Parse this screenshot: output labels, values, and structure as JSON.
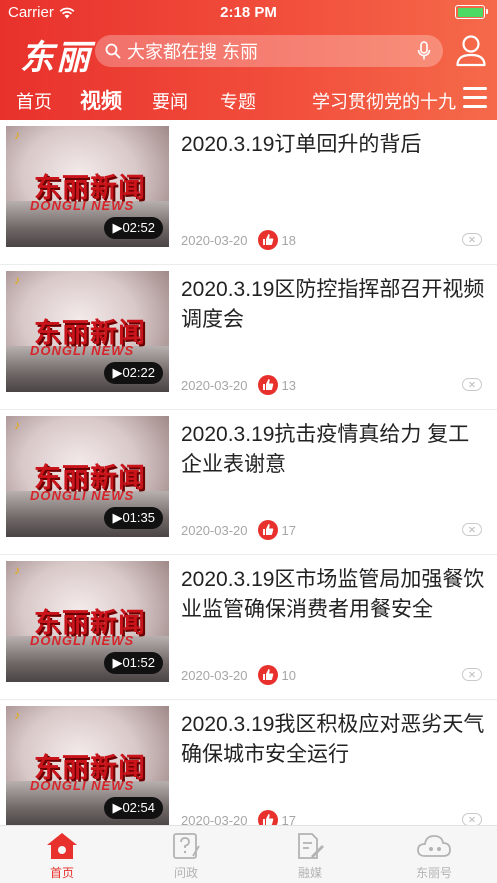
{
  "status_bar": {
    "carrier": "Carrier",
    "time": "2:18 PM"
  },
  "header": {
    "logo": "东丽",
    "search_placeholder": "大家都在搜 东丽",
    "icons": {
      "search": "search-icon",
      "mic": "mic-icon",
      "user": "user-icon"
    }
  },
  "nav": {
    "tabs": [
      {
        "label": "首页",
        "active": false
      },
      {
        "label": "视频",
        "active": true
      },
      {
        "label": "要闻",
        "active": false
      },
      {
        "label": "专题",
        "active": false
      },
      {
        "label": "学习贯彻党的十九",
        "active": false
      }
    ],
    "menu_icon": "menu-icon"
  },
  "thumbnail": {
    "title_cn": "东丽新闻",
    "title_en": "DONGLI NEWS"
  },
  "articles": [
    {
      "title": "2020.3.19订单回升的背后",
      "date": "2020-03-20",
      "likes": "18",
      "duration": "02:52"
    },
    {
      "title": "2020.3.19区防控指挥部召开视频调度会",
      "date": "2020-03-20",
      "likes": "13",
      "duration": "02:22"
    },
    {
      "title": "2020.3.19抗击疫情真给力 复工企业表谢意",
      "date": "2020-03-20",
      "likes": "17",
      "duration": "01:35"
    },
    {
      "title": "2020.3.19区市场监管局加强餐饮业监管确保消费者用餐安全",
      "date": "2020-03-20",
      "likes": "10",
      "duration": "01:52"
    },
    {
      "title": "2020.3.19我区积极应对恶劣天气 确保城市安全运行",
      "date": "2020-03-20",
      "likes": "17",
      "duration": "02:54"
    }
  ],
  "tabbar": [
    {
      "label": "首页",
      "icon": "home-icon",
      "active": true
    },
    {
      "label": "问政",
      "icon": "question-icon",
      "active": false
    },
    {
      "label": "融媒",
      "icon": "media-edit-icon",
      "active": false
    },
    {
      "label": "东丽号",
      "icon": "cloud-icon",
      "active": false
    }
  ],
  "colors": {
    "brand": "#e8312c",
    "inactive": "#b3b3b3",
    "battery": "#4cd964"
  }
}
